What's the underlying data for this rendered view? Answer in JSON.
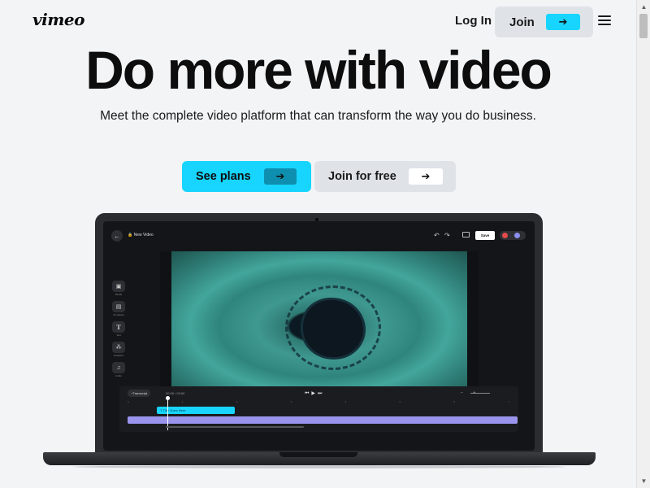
{
  "header": {
    "logo": "vimeo",
    "login_label": "Log In",
    "join_label": "Join"
  },
  "hero": {
    "title": "Do more with video",
    "subtitle": "Meet the complete video platform that can transform the way you do business.",
    "cta_primary": "See plans",
    "cta_secondary": "Join for free"
  },
  "editor": {
    "video_title": "New Video",
    "save_label": "Save",
    "tools": [
      {
        "label": "Media",
        "icon": "image-icon"
      },
      {
        "label": "Templates",
        "icon": "templates-icon"
      },
      {
        "label": "Text",
        "icon": "text-icon"
      },
      {
        "label": "Graphics",
        "icon": "graphics-icon"
      },
      {
        "label": "Audio",
        "icon": "audio-icon"
      }
    ],
    "timeline": {
      "transcript_label": "Transcript",
      "time": "00:06 / 00:60",
      "clip_label": "Title Goes Here",
      "ruler": [
        "0",
        "1",
        "2",
        "3",
        "4",
        "5",
        "6",
        "7"
      ]
    }
  },
  "colors": {
    "accent": "#17d5ff",
    "accent_dark": "#0f8fb0",
    "page_background": "#f3f4f6",
    "button_grey": "#dfe3e8",
    "laptop": "#2a2c30",
    "track_purple": "#9b94ec"
  }
}
